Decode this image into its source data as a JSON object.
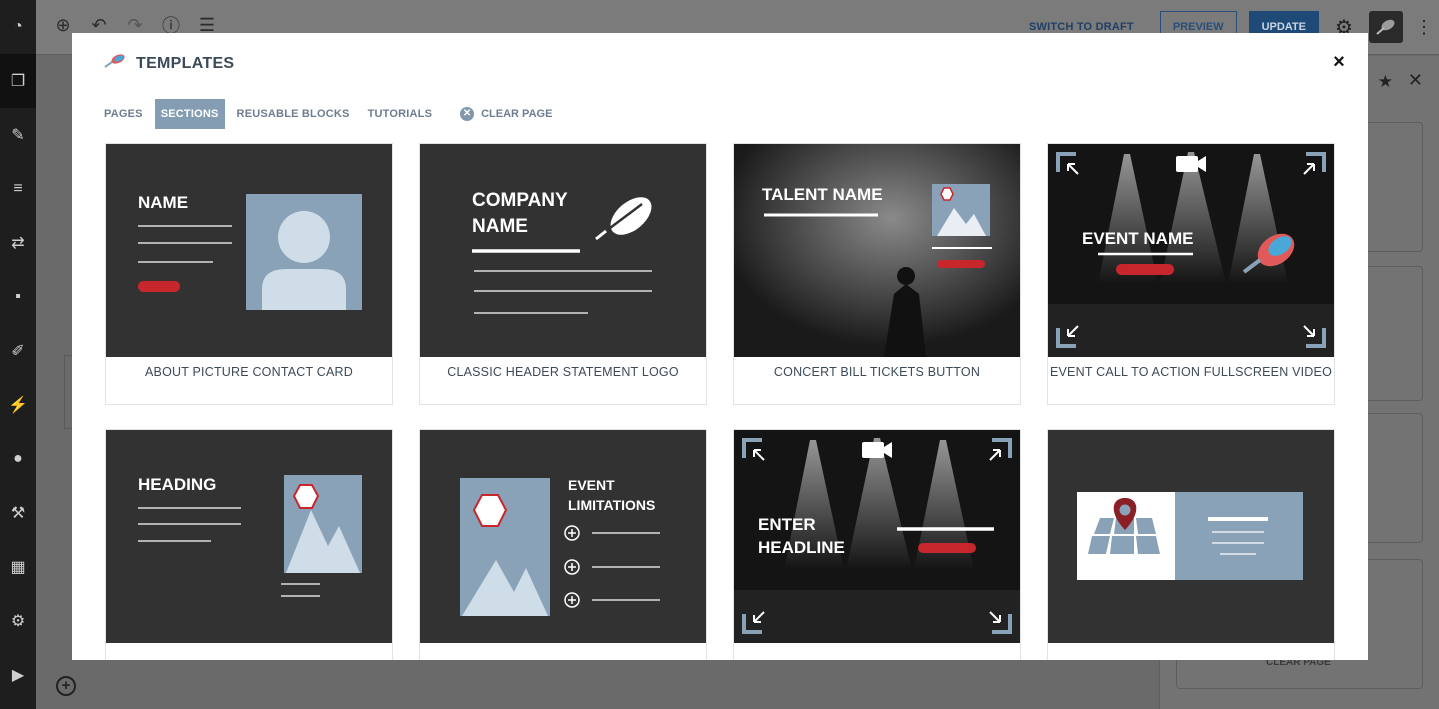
{
  "editor": {
    "toolbar_icons": [
      "add-icon",
      "undo-icon",
      "redo-icon",
      "info-icon",
      "list-icon"
    ],
    "switch_to_draft": "SWITCH TO DRAFT",
    "preview": "PREVIEW",
    "update": "UPDATE",
    "admin_icons": [
      "dashboard-icon",
      "posts-icon",
      "pin-icon",
      "menu-icon",
      "translate-icon",
      "comments-icon",
      "appearance-icon",
      "plugins-icon",
      "users-icon",
      "tools-icon",
      "settings-grid-icon",
      "settings-icon",
      "play-icon"
    ],
    "side_panel_clear": "CLEAR PAGE"
  },
  "modal": {
    "title": "TEMPLATES",
    "close_symbol": "×",
    "tabs": [
      {
        "label": "PAGES",
        "active": false
      },
      {
        "label": "SECTIONS",
        "active": true
      },
      {
        "label": "REUSABLE BLOCKS",
        "active": false
      },
      {
        "label": "TUTORIALS",
        "active": false
      }
    ],
    "clear_page": "CLEAR PAGE",
    "cards": [
      {
        "caption": "ABOUT PICTURE CONTACT CARD",
        "thumb_text": [
          "NAME"
        ]
      },
      {
        "caption": "CLASSIC HEADER STATEMENT LOGO",
        "thumb_text": [
          "COMPANY",
          "NAME"
        ]
      },
      {
        "caption": "CONCERT BILL TICKETS BUTTON",
        "thumb_text": [
          "TALENT NAME"
        ]
      },
      {
        "caption": "EVENT CALL TO ACTION FULLSCREEN VIDEO",
        "thumb_text": [
          "EVENT NAME"
        ]
      },
      {
        "caption": "",
        "thumb_text": [
          "HEADING"
        ]
      },
      {
        "caption": "",
        "thumb_text": [
          "EVENT",
          "LIMITATIONS"
        ]
      },
      {
        "caption": "",
        "thumb_text": [
          "ENTER",
          "HEADLINE"
        ]
      },
      {
        "caption": "",
        "thumb_text": []
      }
    ]
  },
  "colors": {
    "accent": "#849db3",
    "thumb_bg": "#323232",
    "red": "#c8262d",
    "photo_blue": "#8aa2b8",
    "light_blue": "#cfdde8"
  }
}
